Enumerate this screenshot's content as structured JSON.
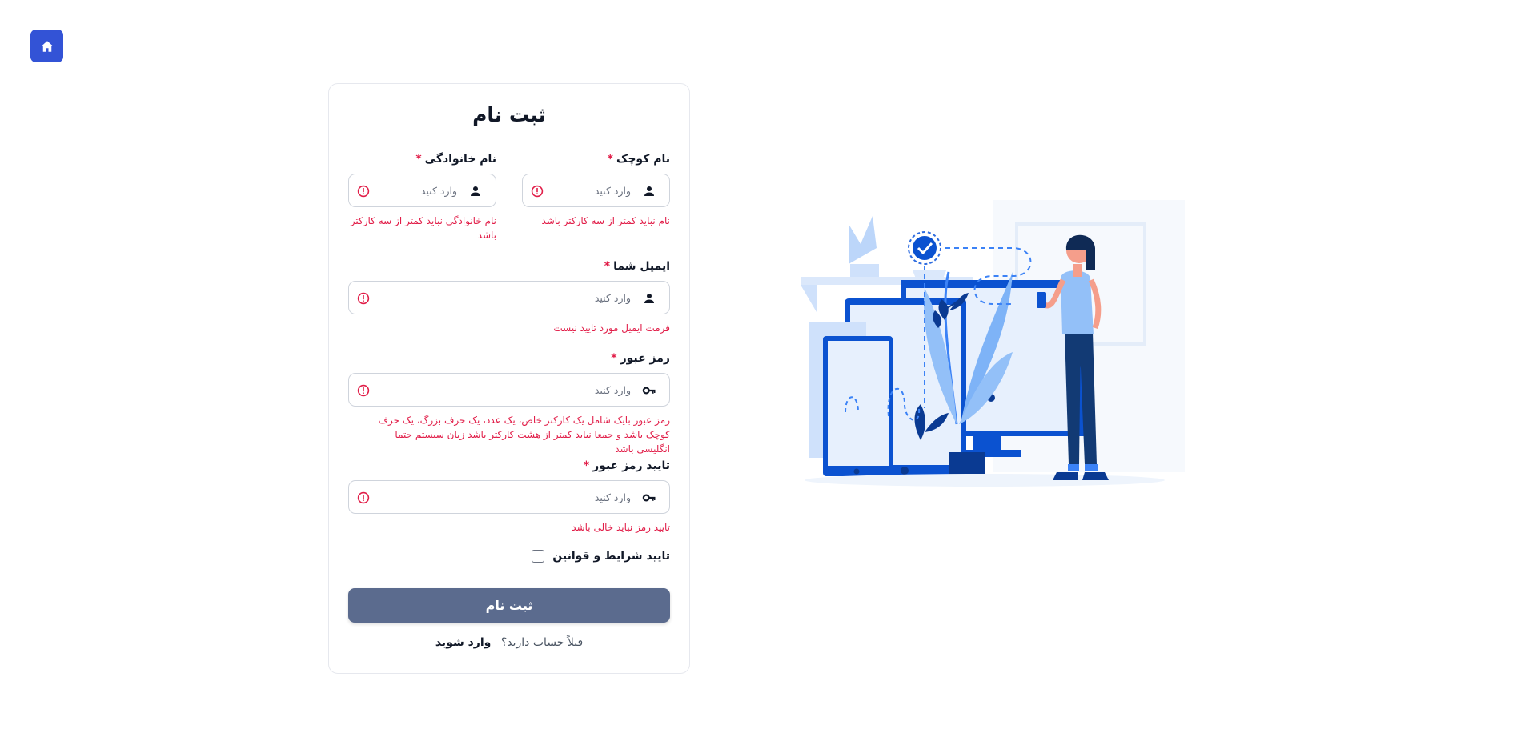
{
  "nav": {
    "home_icon": "home-icon"
  },
  "form": {
    "title": "ثبت نام",
    "required_mark": "*",
    "first_name": {
      "label": "نام کوچک",
      "placeholder": "وارد کنید",
      "value": "",
      "icon": "user-icon",
      "error": "نام نباید کمتر از سه کارکتر باشد"
    },
    "last_name": {
      "label": "نام خانوادگی",
      "placeholder": "وارد کنید",
      "value": "",
      "icon": "user-icon",
      "error": "نام خانوادگی نباید کمتر از سه کارکتر باشد"
    },
    "email": {
      "label": "ایمیل شما",
      "placeholder": "وارد کنید",
      "value": "",
      "icon": "user-icon",
      "error": "فرمت ایمیل مورد تایید نیست"
    },
    "password": {
      "label": "رمز عبور",
      "placeholder": "وارد کنید",
      "value": "",
      "icon": "key-icon",
      "error": "رمز عبور بایک شامل یک کارکتر خاص، یک عدد، یک حرف بزرگ، یک حرف کوچک باشد و جمعا نباید کمتر از هشت کارکتر باشد زبان سیستم حتما انگلیسی باشد"
    },
    "confirm_password": {
      "label": "تایید رمز عبور",
      "placeholder": "وارد کنید",
      "value": "",
      "icon": "key-icon",
      "error": "تایید رمز نباید خالی باشد"
    },
    "terms": {
      "label": "تایید شرایط و قوانین",
      "checked": false
    },
    "submit_label": "ثبت نام",
    "login_prompt": "قبلاً حساب دارید؟",
    "login_link": "وارد شوید"
  },
  "colors": {
    "accent": "#3353d6",
    "error": "#e11d48",
    "submit_bg": "#5b6b8e",
    "illustration_blue": "#0b52d0"
  }
}
